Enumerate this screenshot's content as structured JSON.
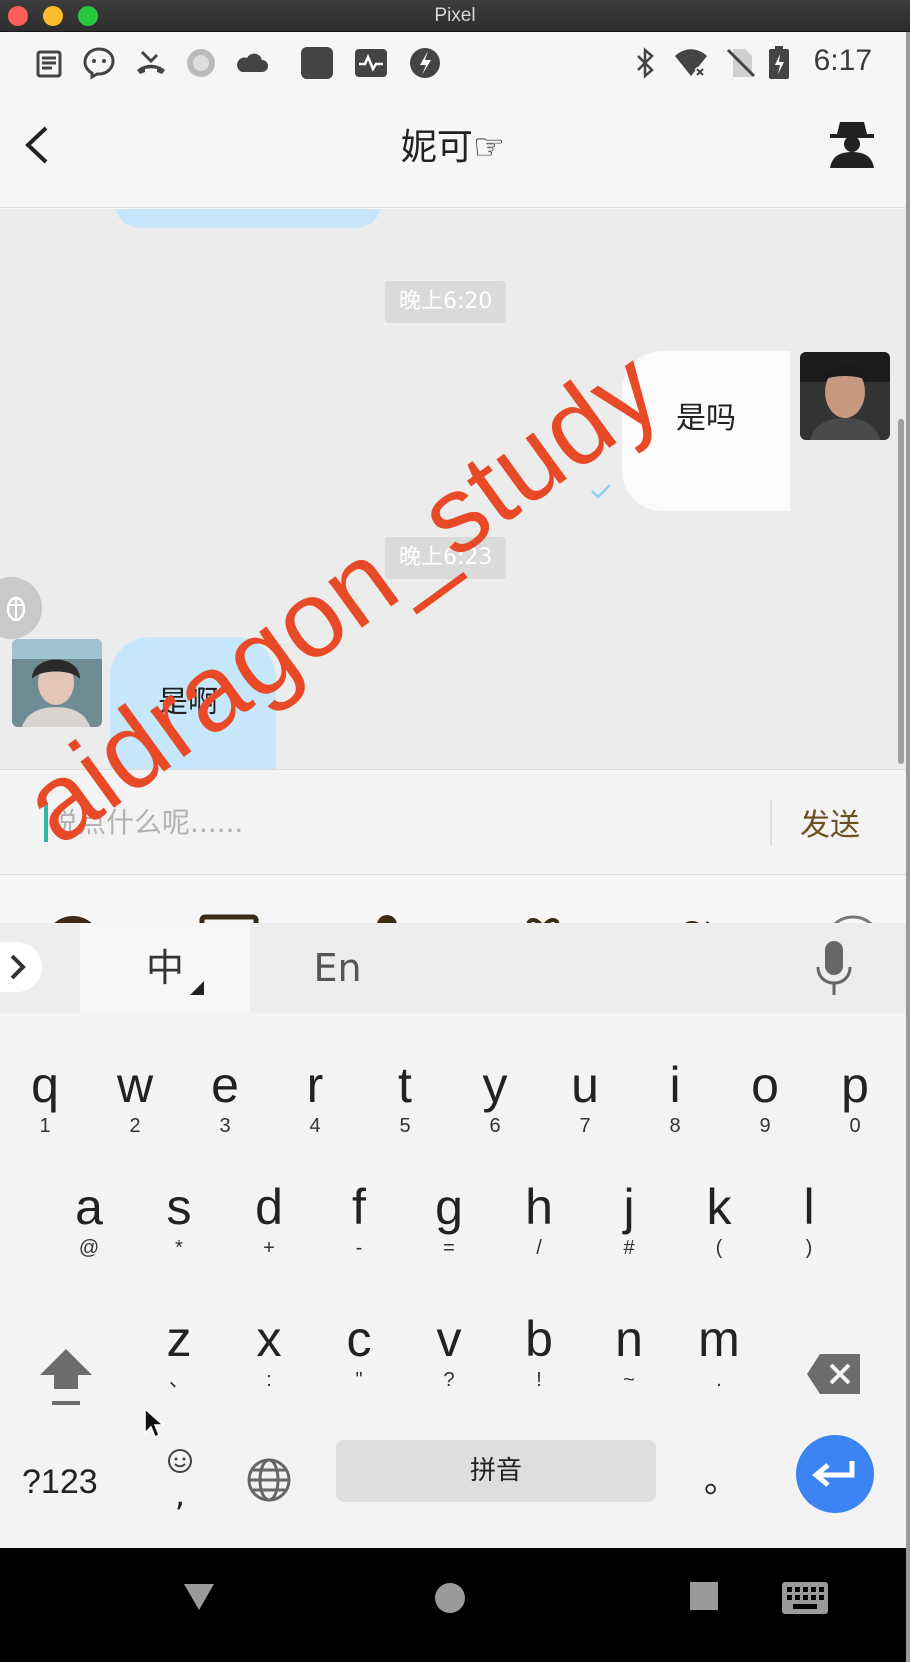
{
  "window": {
    "title": "Pixel"
  },
  "status_bar": {
    "time": "6:17"
  },
  "header": {
    "title": "妮可☞"
  },
  "chat": {
    "timestamps": [
      "晚上6:20",
      "晚上6:23"
    ],
    "messages": [
      {
        "side": "right",
        "text": "是吗"
      },
      {
        "side": "left",
        "text": "是啊"
      }
    ]
  },
  "input": {
    "placeholder": "说点什么呢......",
    "value": "",
    "send_label": "发送"
  },
  "feature_icons": [
    "emoji-icon",
    "image-icon",
    "voice-icon",
    "gift-icon",
    "contacts-icon",
    "add-icon"
  ],
  "keyboard": {
    "tabs": [
      "中",
      "En"
    ],
    "row1": [
      {
        "k": "q",
        "s": "1"
      },
      {
        "k": "w",
        "s": "2"
      },
      {
        "k": "e",
        "s": "3"
      },
      {
        "k": "r",
        "s": "4"
      },
      {
        "k": "t",
        "s": "5"
      },
      {
        "k": "y",
        "s": "6"
      },
      {
        "k": "u",
        "s": "7"
      },
      {
        "k": "i",
        "s": "8"
      },
      {
        "k": "o",
        "s": "9"
      },
      {
        "k": "p",
        "s": "0"
      }
    ],
    "row2": [
      {
        "k": "a",
        "s": "@"
      },
      {
        "k": "s",
        "s": "*"
      },
      {
        "k": "d",
        "s": "+"
      },
      {
        "k": "f",
        "s": "-"
      },
      {
        "k": "g",
        "s": "="
      },
      {
        "k": "h",
        "s": "/"
      },
      {
        "k": "j",
        "s": "#"
      },
      {
        "k": "k",
        "s": "("
      },
      {
        "k": "l",
        "s": ")"
      }
    ],
    "row3": [
      {
        "k": "z",
        "s": "、"
      },
      {
        "k": "x",
        "s": ":"
      },
      {
        "k": "c",
        "s": "\""
      },
      {
        "k": "v",
        "s": "?"
      },
      {
        "k": "b",
        "s": "!"
      },
      {
        "k": "n",
        "s": "~"
      },
      {
        "k": "m",
        "s": "."
      }
    ],
    "symbols_label": "?123",
    "comma_label": ",",
    "space_label": "拼音",
    "period_label": "。"
  },
  "watermark": "aidragon_study",
  "colors": {
    "accent": "#3c84f4",
    "bubble_in": "#c6e7fb",
    "send": "#6a5320",
    "watermark": "#e84a27"
  }
}
